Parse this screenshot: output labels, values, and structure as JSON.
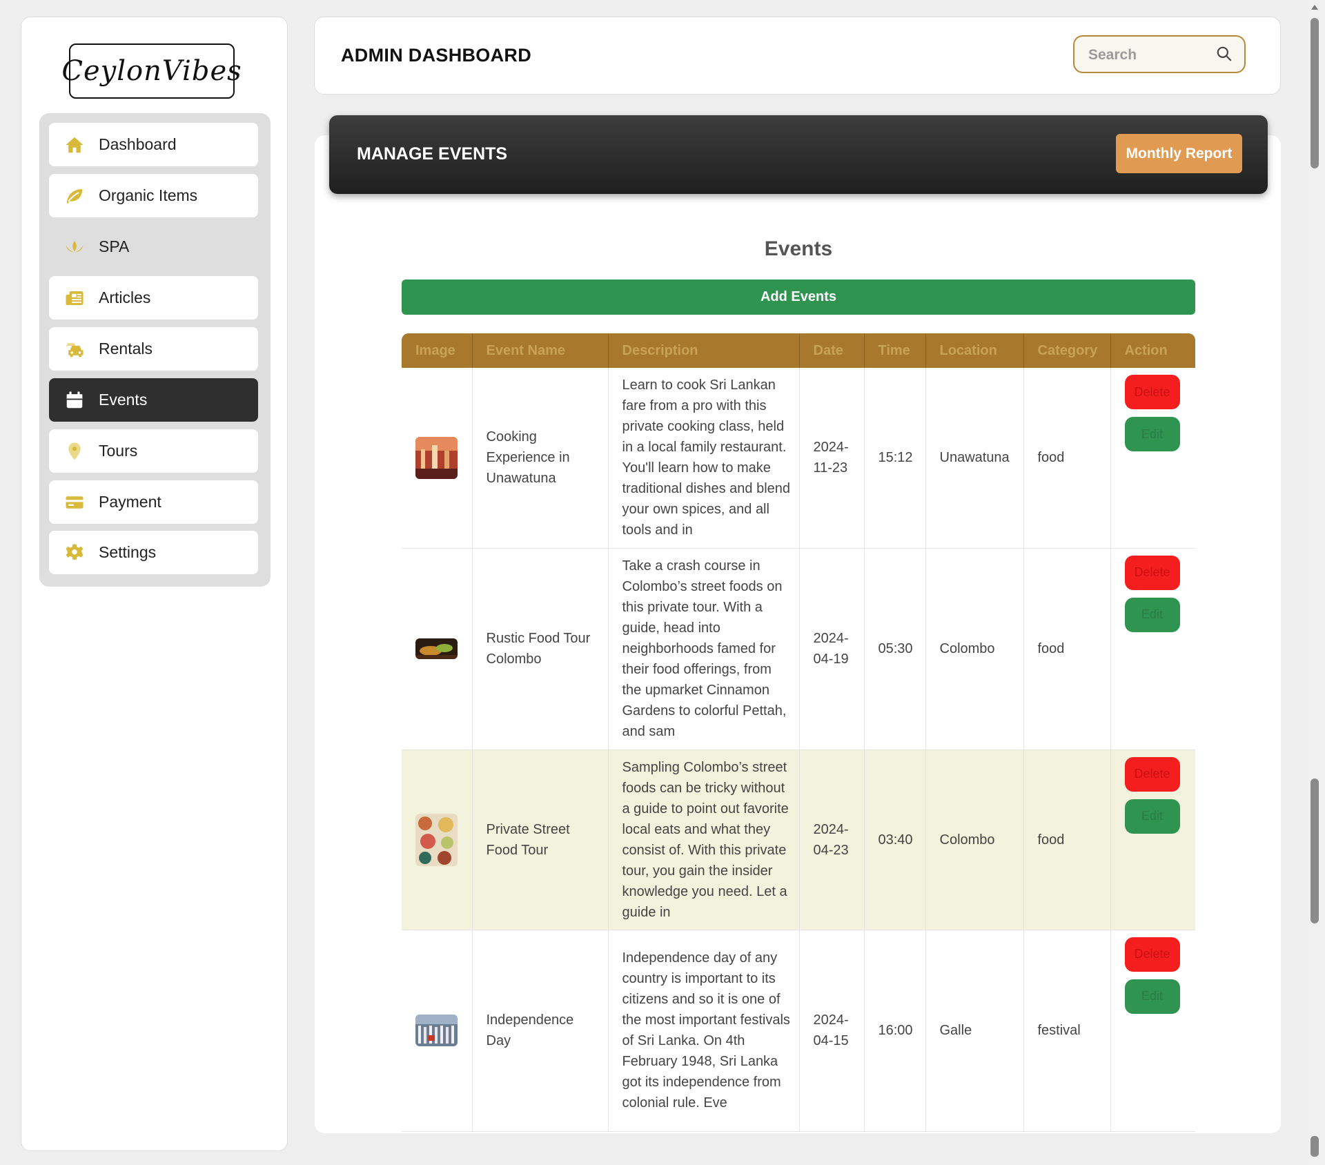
{
  "brand": {
    "logo_text": "CeylonVibes"
  },
  "sidebar": {
    "items": [
      {
        "label": "Dashboard",
        "icon": "home-icon"
      },
      {
        "label": "Organic Items",
        "icon": "leaf-icon"
      },
      {
        "label": "SPA",
        "icon": "lotus-icon"
      },
      {
        "label": "Articles",
        "icon": "newspaper-icon"
      },
      {
        "label": "Rentals",
        "icon": "car-icon"
      },
      {
        "label": "Events",
        "icon": "calendar-icon"
      },
      {
        "label": "Tours",
        "icon": "map-pin-icon"
      },
      {
        "label": "Payment",
        "icon": "credit-card-icon"
      },
      {
        "label": "Settings",
        "icon": "gear-icon"
      }
    ],
    "active": "Events"
  },
  "header": {
    "title": "ADMIN DASHBOARD",
    "search_placeholder": "Search"
  },
  "banner": {
    "title": "MANAGE EVENTS",
    "report_button": "Monthly Report"
  },
  "events_section": {
    "title": "Events",
    "add_button": "Add Events",
    "columns": [
      "Image",
      "Event Name",
      "Description",
      "Date",
      "Time",
      "Location",
      "Category",
      "Action"
    ],
    "rows": [
      {
        "name": "Cooking Experience in Unawatuna",
        "description": "Learn to cook Sri Lankan fare from a pro with this private cooking class, held in a local family restaurant. You'll learn how to make traditional dishes and blend your own spices, and all tools and in",
        "date": "2024-11-23",
        "time": "15:12",
        "location": "Unawatuna",
        "category": "food",
        "delete_label": "Delete",
        "edit_label": "Edit"
      },
      {
        "name": "Rustic Food Tour Colombo",
        "description": "Take a crash course in Colombo’s street foods on this private tour. With a guide, head into neighborhoods famed for their food offerings, from the upmarket Cinnamon Gardens to colorful Pettah, and sam",
        "date": "2024-04-19",
        "time": "05:30",
        "location": "Colombo",
        "category": "food",
        "delete_label": "Delete",
        "edit_label": "Edit"
      },
      {
        "name": "Private Street Food Tour",
        "description": "Sampling Colombo’s street foods can be tricky without a guide to point out favorite local eats and what they consist of. With this private tour, you gain the insider knowledge you need. Let a guide in",
        "date": "2024-04-23",
        "time": "03:40",
        "location": "Colombo",
        "category": "food",
        "delete_label": "Delete",
        "edit_label": "Edit"
      },
      {
        "name": "Independence Day",
        "description": "Independence day of any country is important to its citizens and so it is one of the most important festivals of Sri Lanka. On 4th February 1948, Sri Lanka got its independence from colonial rule. Eve",
        "date": "2024-04-15",
        "time": "16:00",
        "location": "Galle",
        "category": "festival",
        "delete_label": "Delete",
        "edit_label": "Edit"
      }
    ]
  },
  "colors": {
    "accent_gold": "#a8782c",
    "icon_gold": "#d8b93a",
    "green": "#2f9450",
    "red": "#f41e1e",
    "orange": "#e09a52",
    "dark": "#2f2f2f",
    "highlight_row": "#f3f2dc"
  }
}
